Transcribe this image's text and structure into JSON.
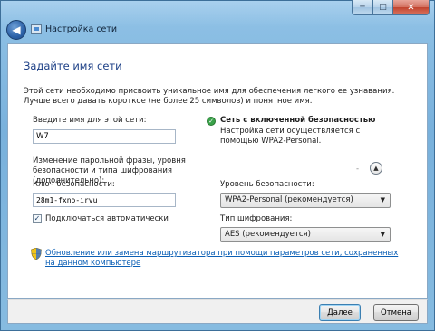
{
  "window": {
    "title": "Настройка сети",
    "min_glyph": "─",
    "max_glyph": "□",
    "close_glyph": "✕",
    "back_glyph": "◀"
  },
  "main": {
    "heading": "Задайте имя сети",
    "description": "Этой сети необходимо присвоить уникальное имя для обеспечения легкого ее узнавания. Лучше всего давать короткое (не более 25 символов) и понятное имя.",
    "network_name_label": "Введите имя для этой сети:",
    "network_name_value": "W7",
    "security_status_title": "Сеть с включенной безопасностью",
    "security_status_text": "Настройка сети осуществляется с помощью WPA2-Personal.",
    "advanced_caption": "Изменение парольной фразы, уровня безопасности и типа шифрования (дополнительно):",
    "key_label": "Ключ безопасности:",
    "key_value": "28m1-fxno-irvu",
    "security_level_label": "Уровень безопасности:",
    "security_level_value": "WPA2-Personal (рекомендуется)",
    "encryption_label": "Тип шифрования:",
    "encryption_value": "AES (рекомендуется)",
    "auto_connect_label": "Подключаться автоматически",
    "auto_connect_checked": true,
    "router_link": "Обновление или замена маршрутизатора при помощи параметров сети, сохраненных на данном компьютере"
  },
  "footer": {
    "next_label": "Далее",
    "cancel_label": "Отмена"
  },
  "colors": {
    "heading": "#1c3f86",
    "link": "#0b5fb5",
    "frame": "#79b1dc"
  }
}
